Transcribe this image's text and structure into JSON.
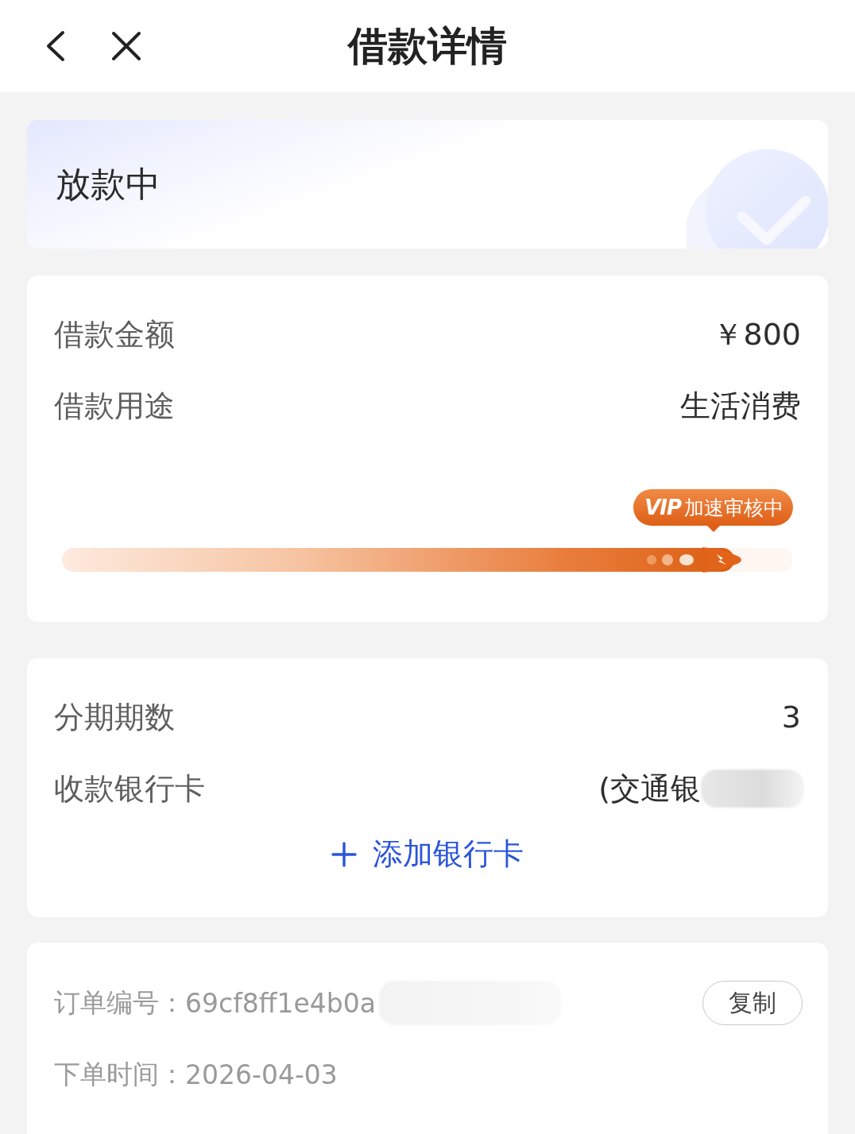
{
  "header": {
    "title": "借款详情"
  },
  "status": {
    "text": "放款中"
  },
  "loan": {
    "rows": [
      {
        "label": "借款金额",
        "value": "￥800"
      },
      {
        "label": "借款用途",
        "value": "生活消费"
      }
    ],
    "progress": {
      "badge_logo": "VIP",
      "badge_text": "加速审核中",
      "level": 0.92
    }
  },
  "repayment": {
    "rows": [
      {
        "label": "分期期数",
        "value": "3",
        "redacted": false
      },
      {
        "label": "收款银行卡",
        "value": "(交通银",
        "redacted": true
      }
    ],
    "add_card": "添加银行卡"
  },
  "order": {
    "rows": [
      {
        "label": "订单编号：",
        "value": "69cf8ff1e4b0a",
        "redacted": true,
        "action": "复制"
      },
      {
        "label": "下单时间：",
        "value": "2026-04-03",
        "redacted": false
      }
    ]
  }
}
